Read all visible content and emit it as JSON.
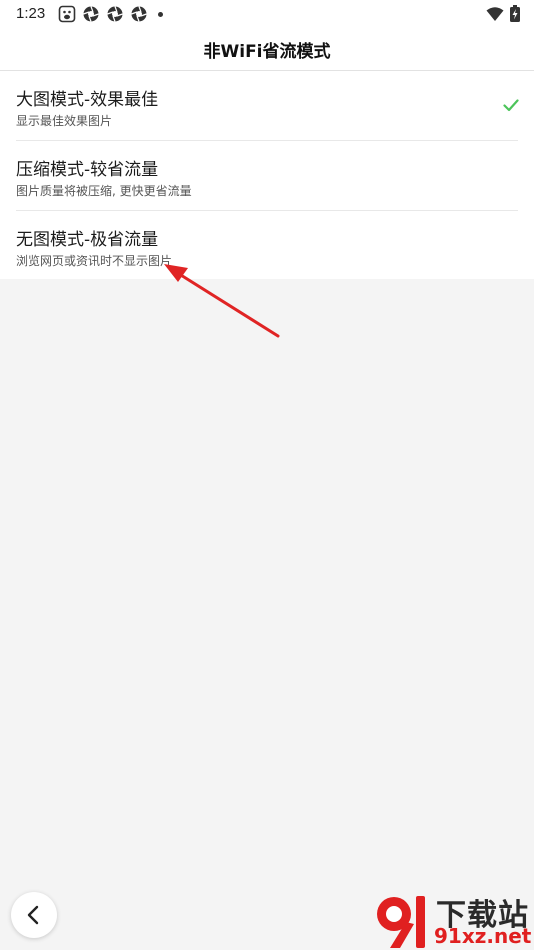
{
  "status_bar": {
    "time": "1:23",
    "icons": [
      "baidu-app-icon",
      "shutter-icon",
      "shutter-icon",
      "shutter-icon"
    ],
    "right_icons": [
      "wifi-icon",
      "battery-charging-icon"
    ]
  },
  "header": {
    "title": "非WiFi省流模式"
  },
  "modes": [
    {
      "title": "大图模式-效果最佳",
      "subtitle": "显示最佳效果图片",
      "selected": true
    },
    {
      "title": "压缩模式-较省流量",
      "subtitle": "图片质量将被压缩, 更快更省流量",
      "selected": false
    },
    {
      "title": "无图模式-极省流量",
      "subtitle": "浏览网页或资讯时不显示图片",
      "selected": false
    }
  ],
  "colors": {
    "accent_check": "#4cc45a",
    "annotation_arrow": "#e02424",
    "watermark_red": "#e02020"
  },
  "watermark": {
    "logo_icon": "91-logo-icon",
    "text_main": "下载站",
    "text_url": "91xz.net"
  }
}
